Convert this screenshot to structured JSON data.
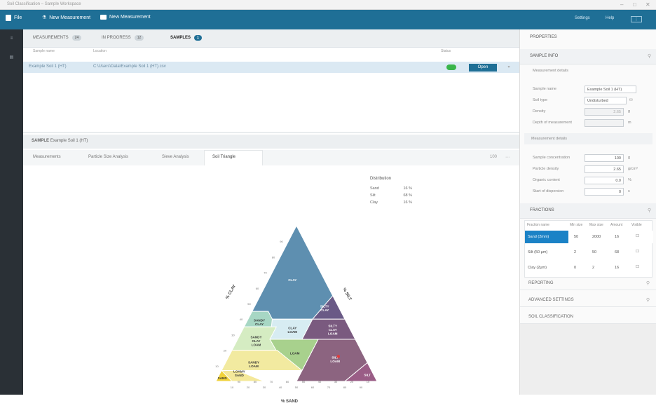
{
  "window": {
    "title": "Soil Classification – Sample Workspace",
    "controls": [
      "–",
      "□",
      "✕"
    ]
  },
  "menubar": {
    "file_label": "File",
    "new_measurement_label": "New Measurement",
    "new_sample_label": "New Measurement",
    "right_items": [
      "Settings",
      "Help",
      "⋮"
    ]
  },
  "leftrail": {
    "items": [
      "≡",
      "▤"
    ]
  },
  "tabs": [
    {
      "label": "MEASUREMENTS",
      "count": "24",
      "active": false
    },
    {
      "label": "IN PROGRESS",
      "count": "12",
      "active": false
    },
    {
      "label": "SAMPLES",
      "count": "1",
      "active": true
    }
  ],
  "table": {
    "columns": [
      "Sample name",
      "Location",
      "Status"
    ],
    "row": {
      "name": "Example Soil 1 (HT)",
      "location": "C:\\Users\\Data\\Example Soil 1 (HT).csv",
      "status": "",
      "action": "Open"
    }
  },
  "sample": {
    "prefix": "SAMPLE",
    "name": "Example Soil 1 (HT)"
  },
  "subtabs": [
    {
      "label": "Measurements",
      "active": false
    },
    {
      "label": "Particle Size Analysis",
      "active": false
    },
    {
      "label": "Sieve Analysis",
      "active": false
    },
    {
      "label": "Soil Triangle",
      "active": true
    }
  ],
  "zoom": {
    "value": "100",
    "menu": "⋯"
  },
  "distribution": {
    "title": "Distribution",
    "rows": [
      {
        "name": "Sand",
        "value": "16 %"
      },
      {
        "name": "Silt",
        "value": "68 %"
      },
      {
        "name": "Clay",
        "value": "16 %"
      }
    ]
  },
  "triangle": {
    "regions": [
      {
        "name": "CLAY",
        "color": "#5e8fb0"
      },
      {
        "name": "SILTY CLAY",
        "color": "#6a5a86"
      },
      {
        "name": "SANDY CLAY",
        "color": "#a7d7c4"
      },
      {
        "name": "CLAY LOAM",
        "color": "#d7ecf2"
      },
      {
        "name": "SILTY CLAY LOAM",
        "color": "#7a5a7f"
      },
      {
        "name": "SANDY CLAY LOAM",
        "color": "#d5ecc2"
      },
      {
        "name": "LOAM",
        "color": "#a8d18d"
      },
      {
        "name": "SANDY LOAM",
        "color": "#f2eaa0"
      },
      {
        "name": "SILT LOAM",
        "color": "#8c6480"
      },
      {
        "name": "SILT",
        "color": "#9a5d86"
      },
      {
        "name": "LOAMY SAND",
        "color": "#f4e89a"
      },
      {
        "name": "SAND",
        "color": "#f0d23c"
      }
    ],
    "left_axis_label": "% CLAY",
    "right_axis_label": "% SILT",
    "bottom_axis_label": "% SAND",
    "ticks": [
      "10",
      "20",
      "30",
      "40",
      "50",
      "60",
      "70",
      "80",
      "90"
    ],
    "marker_color": "#e23b3b"
  },
  "sidepanel": {
    "title": "PROPERTIES",
    "sample_info": {
      "header": "SAMPLE INFO",
      "subheader": "Measurement details",
      "fields": [
        {
          "label": "Sample name",
          "value": "Example Soil 1 (HT)",
          "unit": ""
        },
        {
          "label": "Soil type",
          "value": "Undisturbed",
          "unit": "⛁"
        },
        {
          "label": "Density",
          "value": "2.65",
          "unit": "g"
        },
        {
          "label": "Depth of measurement",
          "value": "",
          "unit": "m"
        }
      ]
    },
    "measurement": {
      "header": "Measurement details",
      "fields": [
        {
          "label": "Sample concentration",
          "value": "100",
          "unit": "g"
        },
        {
          "label": "Particle density",
          "value": "2.65",
          "unit": "g/cm³"
        },
        {
          "label": "Organic content",
          "value": "0.0",
          "unit": "%"
        },
        {
          "label": "Start of dispersion",
          "value": "0",
          "unit": "s"
        }
      ]
    },
    "fractions": {
      "header": "FRACTIONS",
      "columns": [
        "Fraction name",
        "Min size",
        "Max size",
        "Amount",
        "Visible"
      ],
      "rows": [
        {
          "name": "Sand (2mm)",
          "min": "50",
          "max": "2000",
          "amount": "16",
          "visible": "☐",
          "selected": true
        },
        {
          "name": "Silt (50 μm)",
          "min": "2",
          "max": "50",
          "amount": "68",
          "visible": "☐",
          "selected": false
        },
        {
          "name": "Clay (2μm)",
          "min": "0",
          "max": "2",
          "amount": "16",
          "visible": "☐",
          "selected": false
        }
      ]
    },
    "collapsed": [
      {
        "label": "REPORTING",
        "pin": "📌"
      },
      {
        "label": "ADVANCED SETTINGS",
        "pin": "📌"
      },
      {
        "label": "SOIL CLASSIFICATION",
        "pin": ""
      }
    ]
  }
}
